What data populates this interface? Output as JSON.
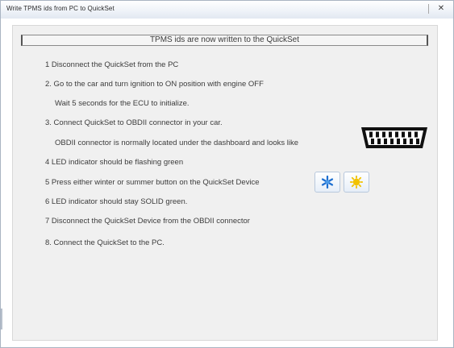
{
  "window": {
    "title": "Write TPMS ids from PC to QuickSet",
    "close_label": "✕"
  },
  "header": {
    "text": "TPMS ids are now written to the QuickSet"
  },
  "steps": [
    "1 Disconnect the QuickSet from the PC",
    "2. Go to the car and turn ignition to ON position with engine OFF",
    "Wait 5 seconds for the ECU to initialize.",
    "3. Connect QuickSet to OBDII connector in your car.",
    "OBDII connector is normally located under the dashboard and looks like",
    "4 LED indicator should be flashing green",
    "5 Press either winter or summer button on the QuickSet Device",
    "6 LED indicator should stay SOLID green.",
    "7 Disconnect the QuickSet Device from the OBDII connector",
    "8. Connect the QuickSet to the PC."
  ],
  "icons": {
    "obd": "obd-connector-icon",
    "winter": "snowflake-icon",
    "summer": "sun-icon"
  },
  "colors": {
    "winter": "#1e6fd0",
    "summer": "#f2c200",
    "obd": "#111111"
  }
}
